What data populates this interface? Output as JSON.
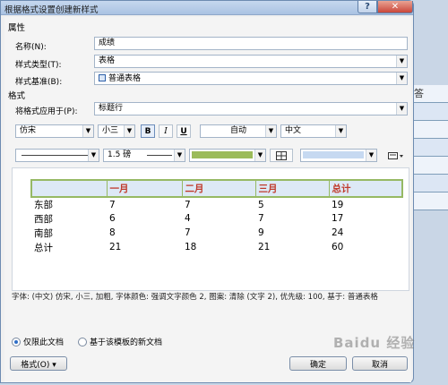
{
  "window": {
    "title": "根据格式设置创建新样式",
    "help": "?",
    "close": "✕"
  },
  "background": {
    "glyph": "答"
  },
  "properties": {
    "section": "属性",
    "name_label": "名称(N):",
    "name_value": "成绩",
    "type_label": "样式类型(T):",
    "type_value": "表格",
    "base_label": "样式基准(B):",
    "base_value": "普通表格"
  },
  "format": {
    "section": "格式",
    "apply_label": "将格式应用于(P):",
    "apply_value": "标题行",
    "font": "仿宋",
    "size": "小三",
    "bold": "B",
    "italic": "I",
    "underline": "U",
    "color": "自动",
    "lang": "中文",
    "border_width": "1.5 磅",
    "shading_color": "#9bbb59",
    "border_color": "#c6d9f1"
  },
  "preview": {
    "headers": [
      "",
      "一月",
      "二月",
      "三月",
      "总计"
    ],
    "rows": [
      [
        "东部",
        "7",
        "7",
        "5",
        "19"
      ],
      [
        "西部",
        "6",
        "4",
        "7",
        "17"
      ],
      [
        "南部",
        "8",
        "7",
        "9",
        "24"
      ],
      [
        "总计",
        "21",
        "18",
        "21",
        "60"
      ]
    ]
  },
  "description": "字体: (中文) 仿宋, 小三, 加粗, 字体颜色: 强调文字颜色 2, 图案: 清除 (文字 2), 优先级: 100, 基于: 普通表格",
  "options": {
    "this_doc": "仅限此文档",
    "new_docs": "基于该模板的新文档"
  },
  "buttons": {
    "format": "格式(O) ▾",
    "ok": "确定",
    "cancel": "取消"
  },
  "watermark": "Baidu 经验"
}
